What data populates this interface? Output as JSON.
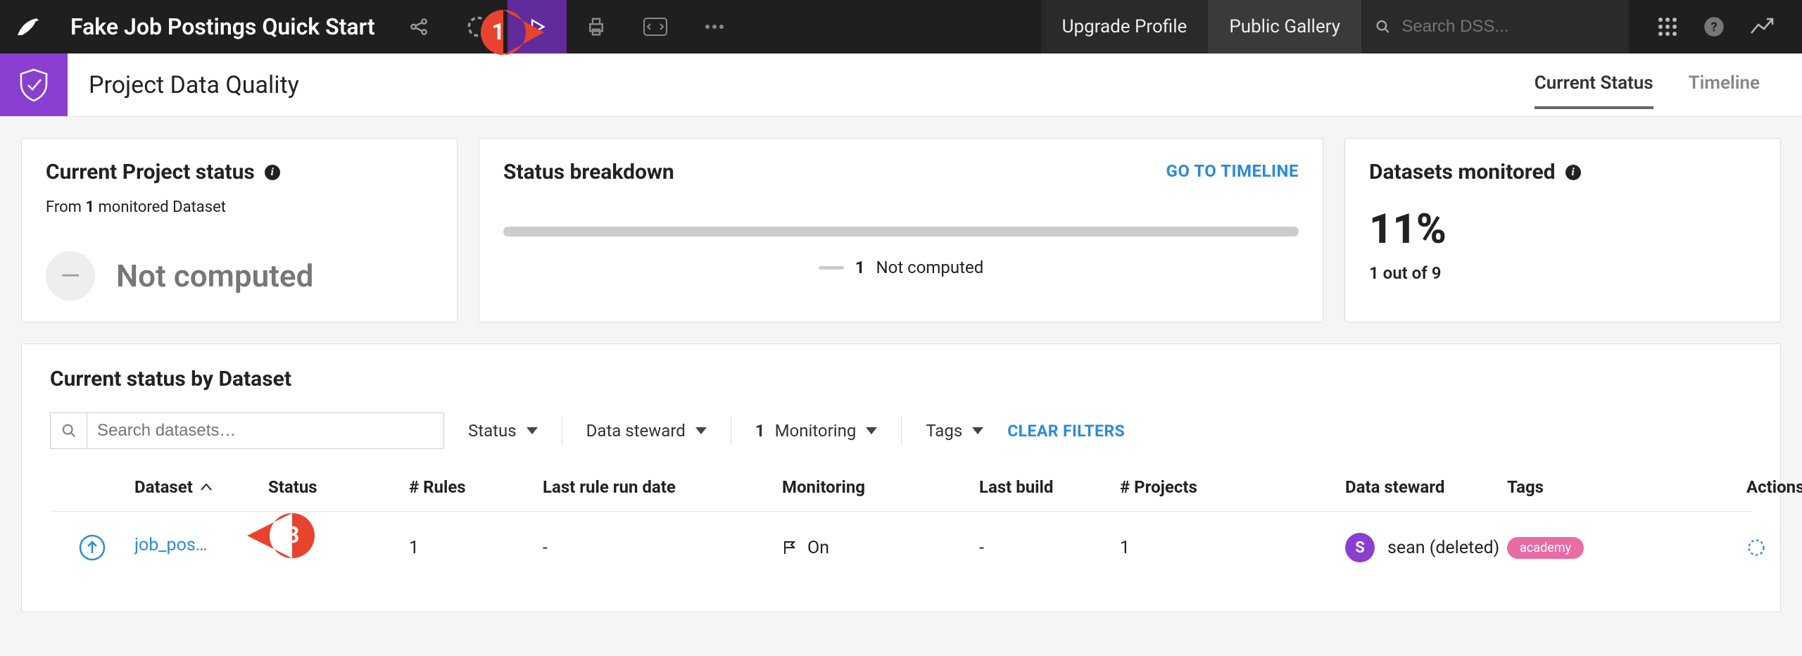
{
  "topbar": {
    "project_title": "Fake Job Postings Quick Start",
    "upgrade_label": "Upgrade Profile",
    "gallery_label": "Public Gallery",
    "search_placeholder": "Search DSS...",
    "callout1": "1"
  },
  "subheader": {
    "page_title": "Project Data Quality",
    "tabs": {
      "current": "Current Status",
      "timeline": "Timeline"
    }
  },
  "cards": {
    "status": {
      "title": "Current Project status",
      "sub_prefix": "From ",
      "sub_count": "1",
      "sub_suffix": " monitored Dataset",
      "status_glyph": "—",
      "status_text": "Not computed"
    },
    "breakdown": {
      "title": "Status breakdown",
      "link": "GO TO TIMELINE",
      "legend_count": "1",
      "legend_label": "Not computed"
    },
    "monitored": {
      "title": "Datasets monitored",
      "percent": "11%",
      "detail": "1 out of 9"
    }
  },
  "panel": {
    "title": "Current status by Dataset",
    "search_placeholder": "Search datasets…",
    "filters": {
      "status": "Status",
      "steward": "Data steward",
      "monitoring_count": "1",
      "monitoring_label": " Monitoring",
      "tags": "Tags",
      "clear": "CLEAR FILTERS"
    },
    "columns": {
      "dataset": "Dataset",
      "status": "Status",
      "rules": "# Rules",
      "last_run": "Last rule run date",
      "monitoring": "Monitoring",
      "last_build": "Last build",
      "projects": "# Projects",
      "steward": "Data steward",
      "tags": "Tags",
      "actions": "Actions"
    },
    "rows": [
      {
        "dataset": "job_pos…",
        "rules": "1",
        "last_run": "-",
        "monitoring": "On",
        "last_build": "-",
        "projects": "1",
        "steward_initial": "S",
        "steward": "sean (deleted)",
        "tag": "academy"
      }
    ],
    "callout3": "3"
  }
}
